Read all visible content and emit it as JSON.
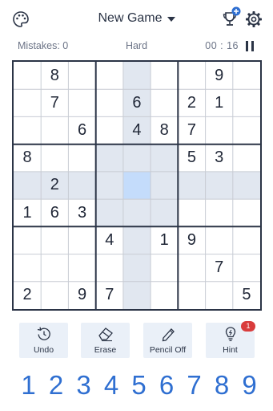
{
  "header": {
    "title": "New Game",
    "icons": [
      "palette-icon",
      "trophy-icon",
      "gear-icon"
    ]
  },
  "status": {
    "mistakes": "Mistakes: 0",
    "difficulty": "Hard",
    "timer": "00 : 16"
  },
  "board": {
    "selected_row": 4,
    "selected_col": 4,
    "rows": [
      [
        "",
        "8",
        "",
        "",
        "",
        "",
        "",
        "9",
        ""
      ],
      [
        "",
        "7",
        "",
        "",
        "6",
        "",
        "2",
        "1",
        ""
      ],
      [
        "",
        "",
        "6",
        "",
        "4",
        "8",
        "7",
        "",
        ""
      ],
      [
        "8",
        "",
        "",
        "",
        "",
        "",
        "5",
        "3",
        ""
      ],
      [
        "",
        "2",
        "",
        "",
        "",
        "",
        "",
        "",
        ""
      ],
      [
        "1",
        "6",
        "3",
        "",
        "",
        "",
        "",
        "",
        ""
      ],
      [
        "",
        "",
        "",
        "4",
        "",
        "1",
        "9",
        "",
        ""
      ],
      [
        "",
        "",
        "",
        "",
        "",
        "",
        "",
        "7",
        ""
      ],
      [
        "2",
        "",
        "9",
        "7",
        "",
        "",
        "",
        "",
        "5"
      ]
    ]
  },
  "actions": {
    "undo": "Undo",
    "erase": "Erase",
    "pencil": "Pencil Off",
    "hint": "Hint",
    "hint_count": "1"
  },
  "numpad": [
    "1",
    "2",
    "3",
    "4",
    "5",
    "6",
    "7",
    "8",
    "9"
  ],
  "colors": {
    "accent": "#2f6fd1",
    "selected_cell": "#c4dcfb",
    "highlight": "#e1e7f0",
    "text": "#1f2636",
    "badge": "#d93c3c"
  }
}
